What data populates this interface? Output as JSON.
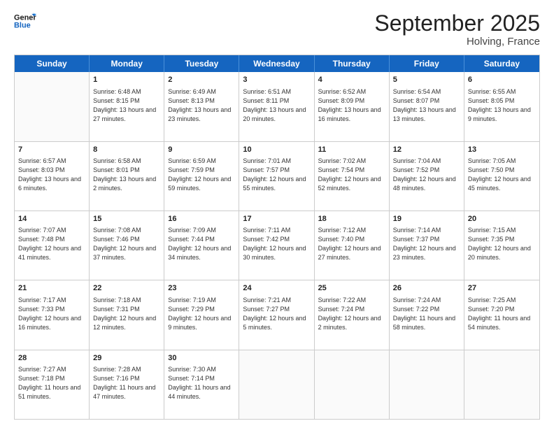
{
  "header": {
    "logo_line1": "General",
    "logo_line2": "Blue",
    "main_title": "September 2025",
    "subtitle": "Holving, France"
  },
  "days_of_week": [
    "Sunday",
    "Monday",
    "Tuesday",
    "Wednesday",
    "Thursday",
    "Friday",
    "Saturday"
  ],
  "weeks": [
    [
      {
        "day": "",
        "empty": true
      },
      {
        "day": "1",
        "sunrise": "Sunrise: 6:48 AM",
        "sunset": "Sunset: 8:15 PM",
        "daylight": "Daylight: 13 hours and 27 minutes."
      },
      {
        "day": "2",
        "sunrise": "Sunrise: 6:49 AM",
        "sunset": "Sunset: 8:13 PM",
        "daylight": "Daylight: 13 hours and 23 minutes."
      },
      {
        "day": "3",
        "sunrise": "Sunrise: 6:51 AM",
        "sunset": "Sunset: 8:11 PM",
        "daylight": "Daylight: 13 hours and 20 minutes."
      },
      {
        "day": "4",
        "sunrise": "Sunrise: 6:52 AM",
        "sunset": "Sunset: 8:09 PM",
        "daylight": "Daylight: 13 hours and 16 minutes."
      },
      {
        "day": "5",
        "sunrise": "Sunrise: 6:54 AM",
        "sunset": "Sunset: 8:07 PM",
        "daylight": "Daylight: 13 hours and 13 minutes."
      },
      {
        "day": "6",
        "sunrise": "Sunrise: 6:55 AM",
        "sunset": "Sunset: 8:05 PM",
        "daylight": "Daylight: 13 hours and 9 minutes."
      }
    ],
    [
      {
        "day": "7",
        "sunrise": "Sunrise: 6:57 AM",
        "sunset": "Sunset: 8:03 PM",
        "daylight": "Daylight: 13 hours and 6 minutes."
      },
      {
        "day": "8",
        "sunrise": "Sunrise: 6:58 AM",
        "sunset": "Sunset: 8:01 PM",
        "daylight": "Daylight: 13 hours and 2 minutes."
      },
      {
        "day": "9",
        "sunrise": "Sunrise: 6:59 AM",
        "sunset": "Sunset: 7:59 PM",
        "daylight": "Daylight: 12 hours and 59 minutes."
      },
      {
        "day": "10",
        "sunrise": "Sunrise: 7:01 AM",
        "sunset": "Sunset: 7:57 PM",
        "daylight": "Daylight: 12 hours and 55 minutes."
      },
      {
        "day": "11",
        "sunrise": "Sunrise: 7:02 AM",
        "sunset": "Sunset: 7:54 PM",
        "daylight": "Daylight: 12 hours and 52 minutes."
      },
      {
        "day": "12",
        "sunrise": "Sunrise: 7:04 AM",
        "sunset": "Sunset: 7:52 PM",
        "daylight": "Daylight: 12 hours and 48 minutes."
      },
      {
        "day": "13",
        "sunrise": "Sunrise: 7:05 AM",
        "sunset": "Sunset: 7:50 PM",
        "daylight": "Daylight: 12 hours and 45 minutes."
      }
    ],
    [
      {
        "day": "14",
        "sunrise": "Sunrise: 7:07 AM",
        "sunset": "Sunset: 7:48 PM",
        "daylight": "Daylight: 12 hours and 41 minutes."
      },
      {
        "day": "15",
        "sunrise": "Sunrise: 7:08 AM",
        "sunset": "Sunset: 7:46 PM",
        "daylight": "Daylight: 12 hours and 37 minutes."
      },
      {
        "day": "16",
        "sunrise": "Sunrise: 7:09 AM",
        "sunset": "Sunset: 7:44 PM",
        "daylight": "Daylight: 12 hours and 34 minutes."
      },
      {
        "day": "17",
        "sunrise": "Sunrise: 7:11 AM",
        "sunset": "Sunset: 7:42 PM",
        "daylight": "Daylight: 12 hours and 30 minutes."
      },
      {
        "day": "18",
        "sunrise": "Sunrise: 7:12 AM",
        "sunset": "Sunset: 7:40 PM",
        "daylight": "Daylight: 12 hours and 27 minutes."
      },
      {
        "day": "19",
        "sunrise": "Sunrise: 7:14 AM",
        "sunset": "Sunset: 7:37 PM",
        "daylight": "Daylight: 12 hours and 23 minutes."
      },
      {
        "day": "20",
        "sunrise": "Sunrise: 7:15 AM",
        "sunset": "Sunset: 7:35 PM",
        "daylight": "Daylight: 12 hours and 20 minutes."
      }
    ],
    [
      {
        "day": "21",
        "sunrise": "Sunrise: 7:17 AM",
        "sunset": "Sunset: 7:33 PM",
        "daylight": "Daylight: 12 hours and 16 minutes."
      },
      {
        "day": "22",
        "sunrise": "Sunrise: 7:18 AM",
        "sunset": "Sunset: 7:31 PM",
        "daylight": "Daylight: 12 hours and 12 minutes."
      },
      {
        "day": "23",
        "sunrise": "Sunrise: 7:19 AM",
        "sunset": "Sunset: 7:29 PM",
        "daylight": "Daylight: 12 hours and 9 minutes."
      },
      {
        "day": "24",
        "sunrise": "Sunrise: 7:21 AM",
        "sunset": "Sunset: 7:27 PM",
        "daylight": "Daylight: 12 hours and 5 minutes."
      },
      {
        "day": "25",
        "sunrise": "Sunrise: 7:22 AM",
        "sunset": "Sunset: 7:24 PM",
        "daylight": "Daylight: 12 hours and 2 minutes."
      },
      {
        "day": "26",
        "sunrise": "Sunrise: 7:24 AM",
        "sunset": "Sunset: 7:22 PM",
        "daylight": "Daylight: 11 hours and 58 minutes."
      },
      {
        "day": "27",
        "sunrise": "Sunrise: 7:25 AM",
        "sunset": "Sunset: 7:20 PM",
        "daylight": "Daylight: 11 hours and 54 minutes."
      }
    ],
    [
      {
        "day": "28",
        "sunrise": "Sunrise: 7:27 AM",
        "sunset": "Sunset: 7:18 PM",
        "daylight": "Daylight: 11 hours and 51 minutes."
      },
      {
        "day": "29",
        "sunrise": "Sunrise: 7:28 AM",
        "sunset": "Sunset: 7:16 PM",
        "daylight": "Daylight: 11 hours and 47 minutes."
      },
      {
        "day": "30",
        "sunrise": "Sunrise: 7:30 AM",
        "sunset": "Sunset: 7:14 PM",
        "daylight": "Daylight: 11 hours and 44 minutes."
      },
      {
        "day": "",
        "empty": true
      },
      {
        "day": "",
        "empty": true
      },
      {
        "day": "",
        "empty": true
      },
      {
        "day": "",
        "empty": true
      }
    ]
  ]
}
